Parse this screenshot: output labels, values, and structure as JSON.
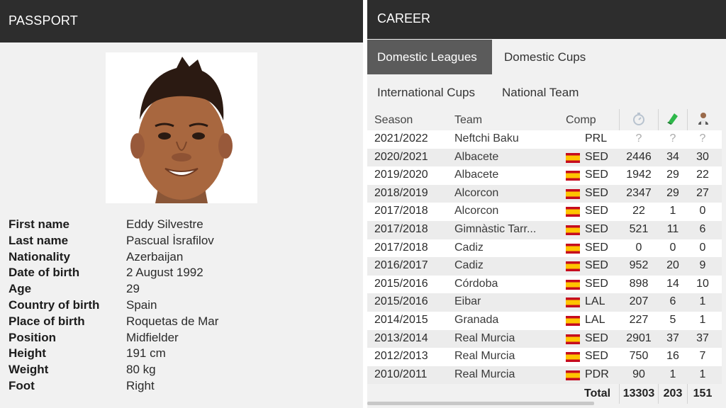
{
  "passport": {
    "title": "PASSPORT",
    "fields": [
      {
        "label": "First name",
        "value": "Eddy Silvestre"
      },
      {
        "label": "Last name",
        "value": "Pascual İsrafilov"
      },
      {
        "label": "Nationality",
        "value": "Azerbaijan"
      },
      {
        "label": "Date of birth",
        "value": "2 August 1992"
      },
      {
        "label": "Age",
        "value": "29"
      },
      {
        "label": "Country of birth",
        "value": "Spain"
      },
      {
        "label": "Place of birth",
        "value": "Roquetas de Mar"
      },
      {
        "label": "Position",
        "value": "Midfielder"
      },
      {
        "label": "Height",
        "value": "191 cm"
      },
      {
        "label": "Weight",
        "value": "80 kg"
      },
      {
        "label": "Foot",
        "value": "Right"
      }
    ]
  },
  "career": {
    "title": "CAREER",
    "tabs": [
      {
        "label": "Domestic Leagues",
        "active": true
      },
      {
        "label": "Domestic Cups",
        "active": false
      },
      {
        "label": "International Cups",
        "active": false
      },
      {
        "label": "National Team",
        "active": false
      }
    ],
    "columns": {
      "season": "Season",
      "team": "Team",
      "comp": "Comp",
      "minutes_icon": "stopwatch-icon",
      "goals_icon": "green-card-icon",
      "apps_icon": "player-icon"
    },
    "rows": [
      {
        "season": "2021/2022",
        "team": "Neftchi Baku",
        "flag": "",
        "comp": "PRL",
        "minutes": "?",
        "goals": "?",
        "apps": "?"
      },
      {
        "season": "2020/2021",
        "team": "Albacete",
        "flag": "spain-flag-icon",
        "comp": "SED",
        "minutes": "2446",
        "goals": "34",
        "apps": "30"
      },
      {
        "season": "2019/2020",
        "team": "Albacete",
        "flag": "spain-flag-icon",
        "comp": "SED",
        "minutes": "1942",
        "goals": "29",
        "apps": "22"
      },
      {
        "season": "2018/2019",
        "team": "Alcorcon",
        "flag": "spain-flag-icon",
        "comp": "SED",
        "minutes": "2347",
        "goals": "29",
        "apps": "27"
      },
      {
        "season": "2017/2018",
        "team": "Alcorcon",
        "flag": "spain-flag-icon",
        "comp": "SED",
        "minutes": "22",
        "goals": "1",
        "apps": "0"
      },
      {
        "season": "2017/2018",
        "team": "Gimnàstic Tarr...",
        "flag": "spain-flag-icon",
        "comp": "SED",
        "minutes": "521",
        "goals": "11",
        "apps": "6"
      },
      {
        "season": "2017/2018",
        "team": "Cadiz",
        "flag": "spain-flag-icon",
        "comp": "SED",
        "minutes": "0",
        "goals": "0",
        "apps": "0"
      },
      {
        "season": "2016/2017",
        "team": "Cadiz",
        "flag": "spain-flag-icon",
        "comp": "SED",
        "minutes": "952",
        "goals": "20",
        "apps": "9"
      },
      {
        "season": "2015/2016",
        "team": "Córdoba",
        "flag": "spain-flag-icon",
        "comp": "SED",
        "minutes": "898",
        "goals": "14",
        "apps": "10"
      },
      {
        "season": "2015/2016",
        "team": "Eibar",
        "flag": "spain-flag-icon",
        "comp": "LAL",
        "minutes": "207",
        "goals": "6",
        "apps": "1"
      },
      {
        "season": "2014/2015",
        "team": "Granada",
        "flag": "spain-flag-icon",
        "comp": "LAL",
        "minutes": "227",
        "goals": "5",
        "apps": "1"
      },
      {
        "season": "2013/2014",
        "team": "Real Murcia",
        "flag": "spain-flag-icon",
        "comp": "SED",
        "minutes": "2901",
        "goals": "37",
        "apps": "37"
      },
      {
        "season": "2012/2013",
        "team": "Real Murcia",
        "flag": "spain-flag-icon",
        "comp": "SED",
        "minutes": "750",
        "goals": "16",
        "apps": "7"
      },
      {
        "season": "2010/2011",
        "team": "Real Murcia",
        "flag": "spain-flag-icon",
        "comp": "PDR",
        "minutes": "90",
        "goals": "1",
        "apps": "1"
      }
    ],
    "total": {
      "label": "Total",
      "minutes": "13303",
      "goals": "203",
      "apps": "151"
    }
  },
  "colors": {
    "header_bg": "#2d2d2d",
    "active_tab_bg": "#5b5b5b",
    "panel_bg": "#f1f1f1"
  }
}
